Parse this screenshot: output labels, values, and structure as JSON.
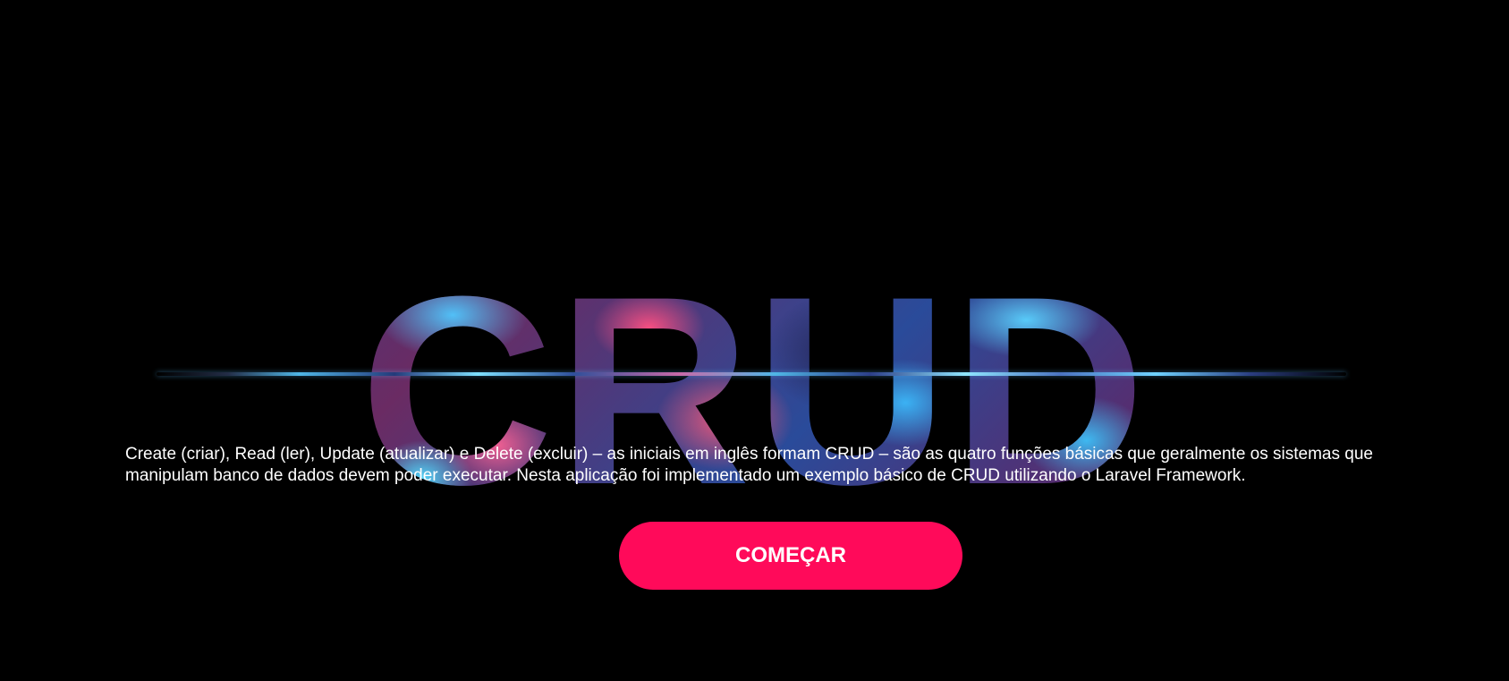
{
  "hero": {
    "title": "CRUD"
  },
  "intro": {
    "text": "Create (criar), Read (ler), Update (atualizar) e Delete (excluir) – as iniciais em inglês formam CRUD – são as quatro funções básicas que geralmente os sistemas que manipulam banco de dados devem poder executar. Nesta aplicação foi implementado um exemplo básico de CRUD utilizando o Laravel Framework."
  },
  "cta": {
    "label": "COMEÇAR"
  },
  "colors": {
    "background": "#000000",
    "text": "#ffffff",
    "button": "#ff0a5a",
    "title_accent_blue": "#4fb6e6",
    "title_accent_pink": "#ff5082"
  }
}
